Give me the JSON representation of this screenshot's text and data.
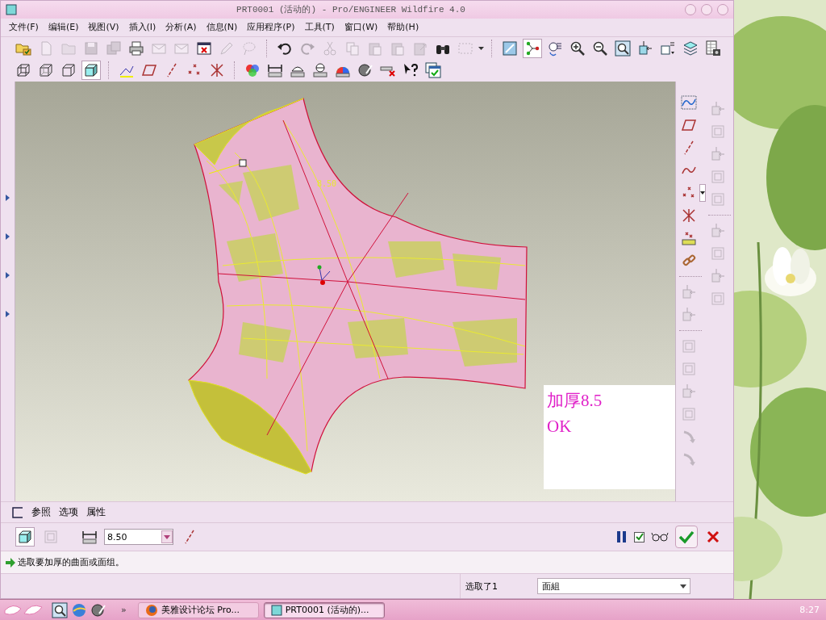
{
  "window": {
    "title": "PRT0001 (活动的) - Pro/ENGINEER Wildfire 4.0"
  },
  "menu": [
    "文件(F)",
    "编辑(E)",
    "视图(V)",
    "插入(I)",
    "分析(A)",
    "信息(N)",
    "应用程序(P)",
    "工具(T)",
    "窗口(W)",
    "帮助(H)"
  ],
  "toolbar_top": [
    {
      "disabled": false,
      "selected": false
    },
    {
      "disabled": true,
      "selected": false
    },
    {
      "disabled": true,
      "selected": false
    },
    {
      "disabled": true,
      "selected": false
    },
    {
      "disabled": true,
      "selected": false
    },
    {
      "disabled": false,
      "selected": false
    },
    {
      "disabled": true,
      "selected": false
    },
    {
      "disabled": true,
      "selected": false
    },
    {
      "disabled": false,
      "selected": false
    },
    {
      "disabled": true,
      "selected": false
    },
    {
      "disabled": true,
      "selected": false
    },
    {
      "disabled": false,
      "selected": false
    },
    {
      "disabled": true,
      "selected": false
    },
    {
      "disabled": true,
      "selected": false
    },
    {
      "disabled": true,
      "selected": false
    },
    {
      "disabled": true,
      "selected": false
    },
    {
      "disabled": true,
      "selected": false
    },
    {
      "disabled": true,
      "selected": false
    },
    {
      "disabled": false,
      "selected": false
    },
    {
      "disabled": true,
      "selected": false
    },
    {
      "disabled": false,
      "selected": false
    },
    {
      "disabled": false,
      "selected": true
    },
    {
      "disabled": false,
      "selected": false
    },
    {
      "disabled": false,
      "selected": false
    },
    {
      "disabled": false,
      "selected": false
    },
    {
      "disabled": false,
      "selected": false
    },
    {
      "disabled": false,
      "selected": false
    },
    {
      "disabled": false,
      "selected": false
    },
    {
      "disabled": false,
      "selected": false
    },
    {
      "disabled": false,
      "selected": false
    }
  ],
  "toolbar_view": [
    {
      "disabled": false,
      "selected": false
    },
    {
      "disabled": false,
      "selected": false
    },
    {
      "disabled": false,
      "selected": false
    },
    {
      "disabled": false,
      "selected": true
    },
    {
      "disabled": false,
      "selected": false
    },
    {
      "disabled": false,
      "selected": false
    },
    {
      "disabled": false,
      "selected": false
    },
    {
      "disabled": false,
      "selected": false
    },
    {
      "disabled": false,
      "selected": false
    },
    {
      "disabled": false,
      "selected": false
    },
    {
      "disabled": false,
      "selected": false
    },
    {
      "disabled": false,
      "selected": false
    },
    {
      "disabled": false,
      "selected": false
    },
    {
      "disabled": false,
      "selected": false
    },
    {
      "disabled": false,
      "selected": false
    },
    {
      "disabled": false,
      "selected": false
    },
    {
      "disabled": false,
      "selected": false
    },
    {
      "disabled": false,
      "selected": false
    }
  ],
  "right_toolbar": {
    "column_1": [
      {
        "disabled": false
      },
      {
        "disabled": false
      },
      {
        "disabled": false
      },
      {
        "disabled": false
      },
      {
        "disabled": false
      },
      {
        "disabled": false
      },
      {
        "disabled": false
      },
      {
        "disabled": false
      },
      {
        "disabled": true
      },
      {
        "disabled": true
      },
      {
        "disabled": true
      },
      {
        "disabled": true
      },
      {
        "disabled": true
      },
      {
        "disabled": true
      },
      {
        "disabled": true
      },
      {
        "disabled": true
      }
    ],
    "column_2": [
      {
        "disabled": true
      },
      {
        "disabled": true
      },
      {
        "disabled": true
      },
      {
        "disabled": true
      },
      {
        "disabled": true
      },
      {
        "disabled": true
      },
      {
        "disabled": true
      },
      {
        "disabled": true
      },
      {
        "disabled": true
      }
    ]
  },
  "viewport": {
    "dimension": "8.50",
    "note": [
      "加厚8.5",
      "OK"
    ]
  },
  "dashboard": {
    "tabs": [
      "参照",
      "选项",
      "属性"
    ],
    "thickness": "8.50",
    "preview_checked": true
  },
  "message": "选取要加厚的曲面或面组。",
  "status_bar": {
    "selection": "选取了1",
    "filter": "面組"
  },
  "taskbar": {
    "more": "»",
    "tasks": [
      {
        "label": "美雅设计论坛 Pro...",
        "selected": false
      },
      {
        "label": "PRT0001 (活动的)...",
        "selected": true
      }
    ],
    "clock": "8:27"
  }
}
